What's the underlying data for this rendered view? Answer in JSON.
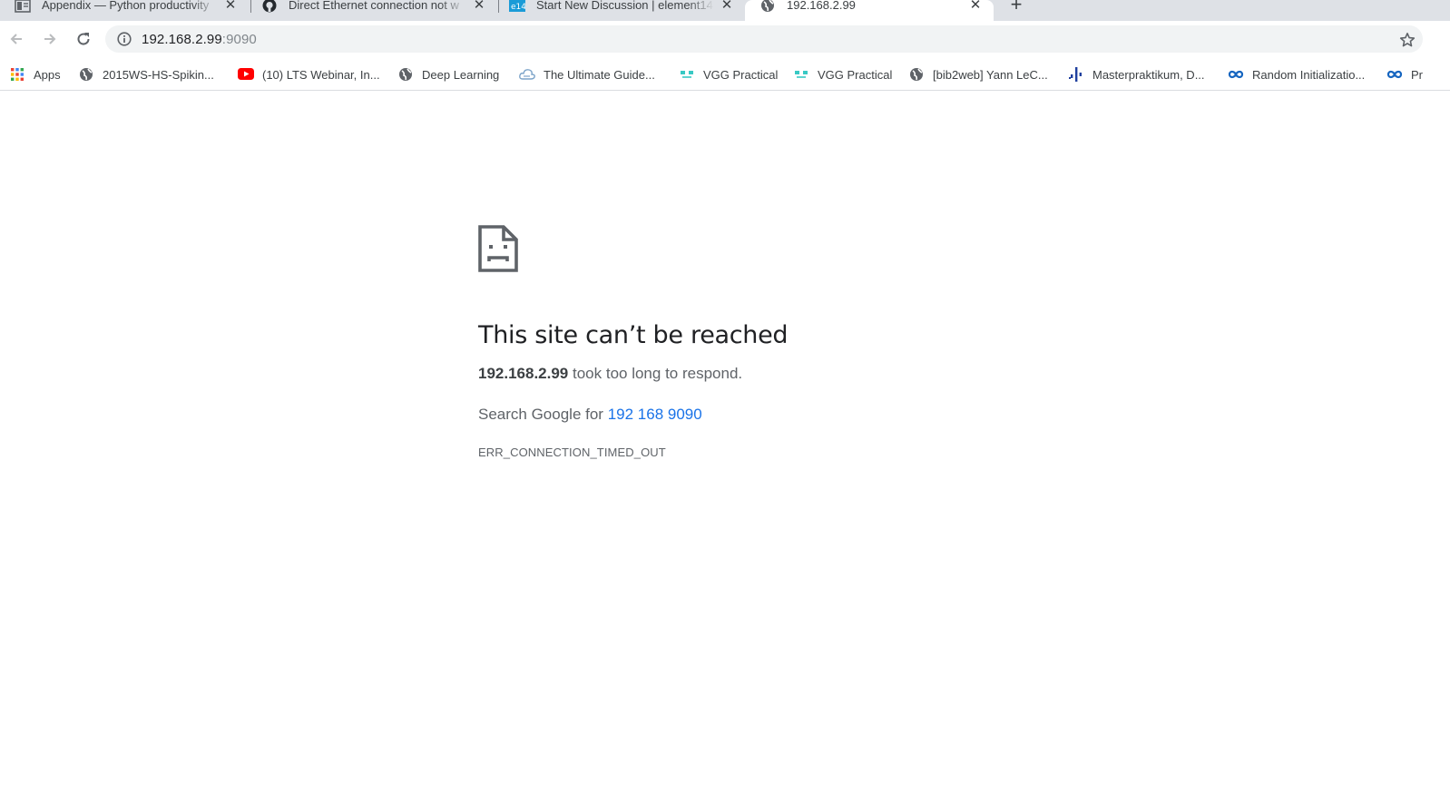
{
  "tabs": [
    {
      "title": "Appendix — Python productivity",
      "icon": "document-icon",
      "active": false
    },
    {
      "title": "Direct Ethernet connection not w",
      "icon": "github-icon",
      "active": false
    },
    {
      "title": "Start New Discussion | element14",
      "icon": "element14-icon",
      "active": false
    },
    {
      "title": "192.168.2.99",
      "icon": "globe-icon",
      "active": true
    }
  ],
  "tab_close_glyph": "✕",
  "new_tab_glyph": "+",
  "toolbar": {
    "url_host": "192.168.2.99",
    "url_port": ":9090"
  },
  "bookmarks": [
    {
      "label": "Apps",
      "icon": "apps-grid-icon"
    },
    {
      "label": "2015WS-HS-Spikin...",
      "icon": "globe-icon"
    },
    {
      "label": "(10) LTS Webinar, In...",
      "icon": "youtube-icon"
    },
    {
      "label": "Deep Learning",
      "icon": "globe-icon"
    },
    {
      "label": "The Ultimate Guide...",
      "icon": "cloud-icon"
    },
    {
      "label": "VGG Practical",
      "icon": "vgg-icon"
    },
    {
      "label": "VGG Practical",
      "icon": "vgg-icon"
    },
    {
      "label": "[bib2web] Yann LeC...",
      "icon": "globe-icon"
    },
    {
      "label": "Masterpraktikum, D...",
      "icon": "chart-icon"
    },
    {
      "label": "Random Initializatio...",
      "icon": "infinity-icon"
    },
    {
      "label": "Pr",
      "icon": "infinity-icon"
    }
  ],
  "error": {
    "title": "This site can’t be reached",
    "host": "192.168.2.99",
    "summary_rest": " took too long to respond.",
    "suggest_prefix": "Search Google for ",
    "suggest_link": "192 168 9090",
    "code": "ERR_CONNECTION_TIMED_OUT"
  },
  "colors": {
    "tabstrip": "#dee1e6",
    "link": "#1a73e8",
    "title": "#202124",
    "secondary_text": "#5f6368"
  }
}
